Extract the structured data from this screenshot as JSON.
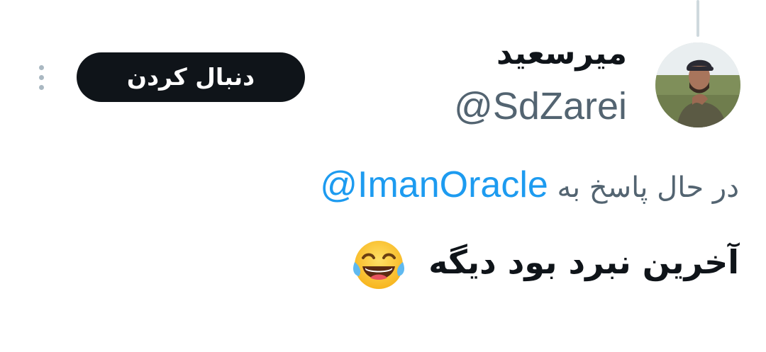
{
  "author": {
    "display_name": "میرسعید",
    "handle": "@SdZarei"
  },
  "follow_label": "دنبال کردن",
  "reply": {
    "prefix": "در حال پاسخ به",
    "mention": "@ImanOracle"
  },
  "tweet": {
    "text": "آخرین نبرد بود دیگه",
    "emoji": "face-with-tears-of-joy"
  },
  "colors": {
    "text": "#0f1419",
    "secondary": "#536471",
    "link": "#1d9bf0",
    "button_bg": "#0f1419",
    "thread_line": "#cfd9de"
  },
  "icons": {
    "more": "more-vertical-icon",
    "emoji": "face-with-tears-of-joy-icon"
  }
}
